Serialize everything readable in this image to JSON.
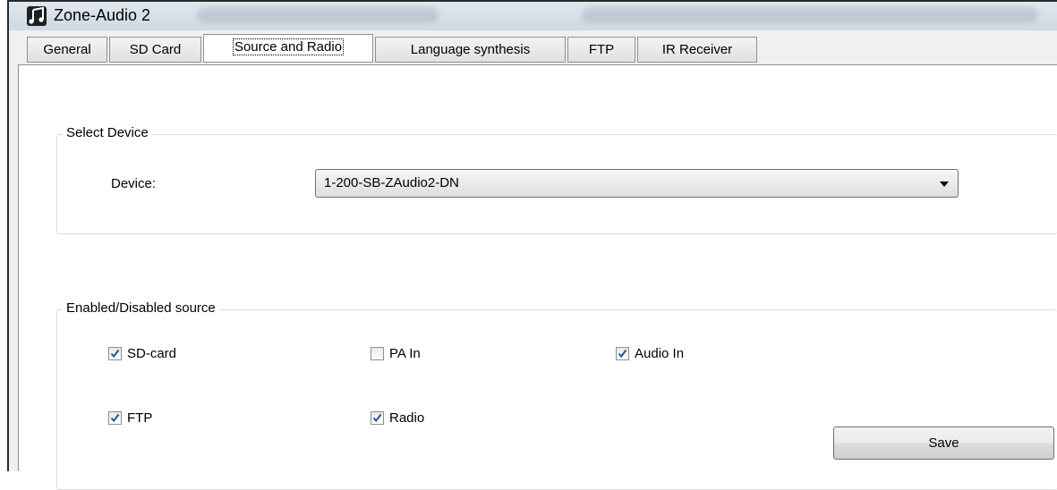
{
  "window": {
    "title": "Zone-Audio 2",
    "icon": "music-notes-icon"
  },
  "tabs": [
    {
      "label": "General",
      "active": false
    },
    {
      "label": "SD Card",
      "active": false
    },
    {
      "label": "Source and Radio",
      "active": true
    },
    {
      "label": "Language synthesis",
      "active": false
    },
    {
      "label": "FTP",
      "active": false
    },
    {
      "label": "IR Receiver",
      "active": false
    }
  ],
  "select_device": {
    "legend": "Select Device",
    "device_label": "Device:",
    "device_value": "1-200-SB-ZAudio2-DN"
  },
  "sources": {
    "legend": "Enabled/Disabled source",
    "sd_card": {
      "label": "SD-card",
      "checked": true
    },
    "pa_in": {
      "label": "PA In",
      "checked": false
    },
    "audio_in": {
      "label": "Audio In",
      "checked": true
    },
    "ftp": {
      "label": "FTP",
      "checked": true
    },
    "radio": {
      "label": "Radio",
      "checked": true
    }
  },
  "actions": {
    "save_label": "Save"
  },
  "colors": {
    "checkmark": "#2b4fa8",
    "titlebar": "#d6e0ea"
  }
}
